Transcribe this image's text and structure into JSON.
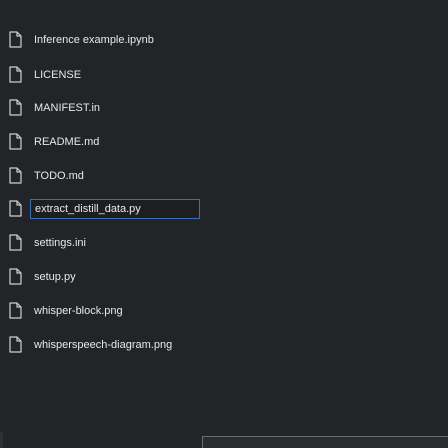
{
  "file_explorer": {
    "files": [
      {
        "name": "Inference example.ipynb",
        "icon": "file-icon"
      },
      {
        "name": "LICENSE",
        "icon": "file-icon"
      },
      {
        "name": "MANIFEST.in",
        "icon": "file-icon"
      },
      {
        "name": "README.md",
        "icon": "file-icon"
      },
      {
        "name": "TODO.md",
        "icon": "file-icon"
      },
      {
        "name": "extract_distill_data.py",
        "icon": "file-icon",
        "renaming": true
      },
      {
        "name": "settings.ini",
        "icon": "file-icon"
      },
      {
        "name": "setup.py",
        "icon": "file-icon"
      },
      {
        "name": "whisper-block.png",
        "icon": "file-icon"
      },
      {
        "name": "whisperspeech-diagram.png",
        "icon": "file-icon"
      }
    ]
  },
  "colors": {
    "background": "#222427",
    "text": "#e8e8e8",
    "icon_stroke": "#d0d0d0",
    "rename_border": "#3b6fb6"
  }
}
